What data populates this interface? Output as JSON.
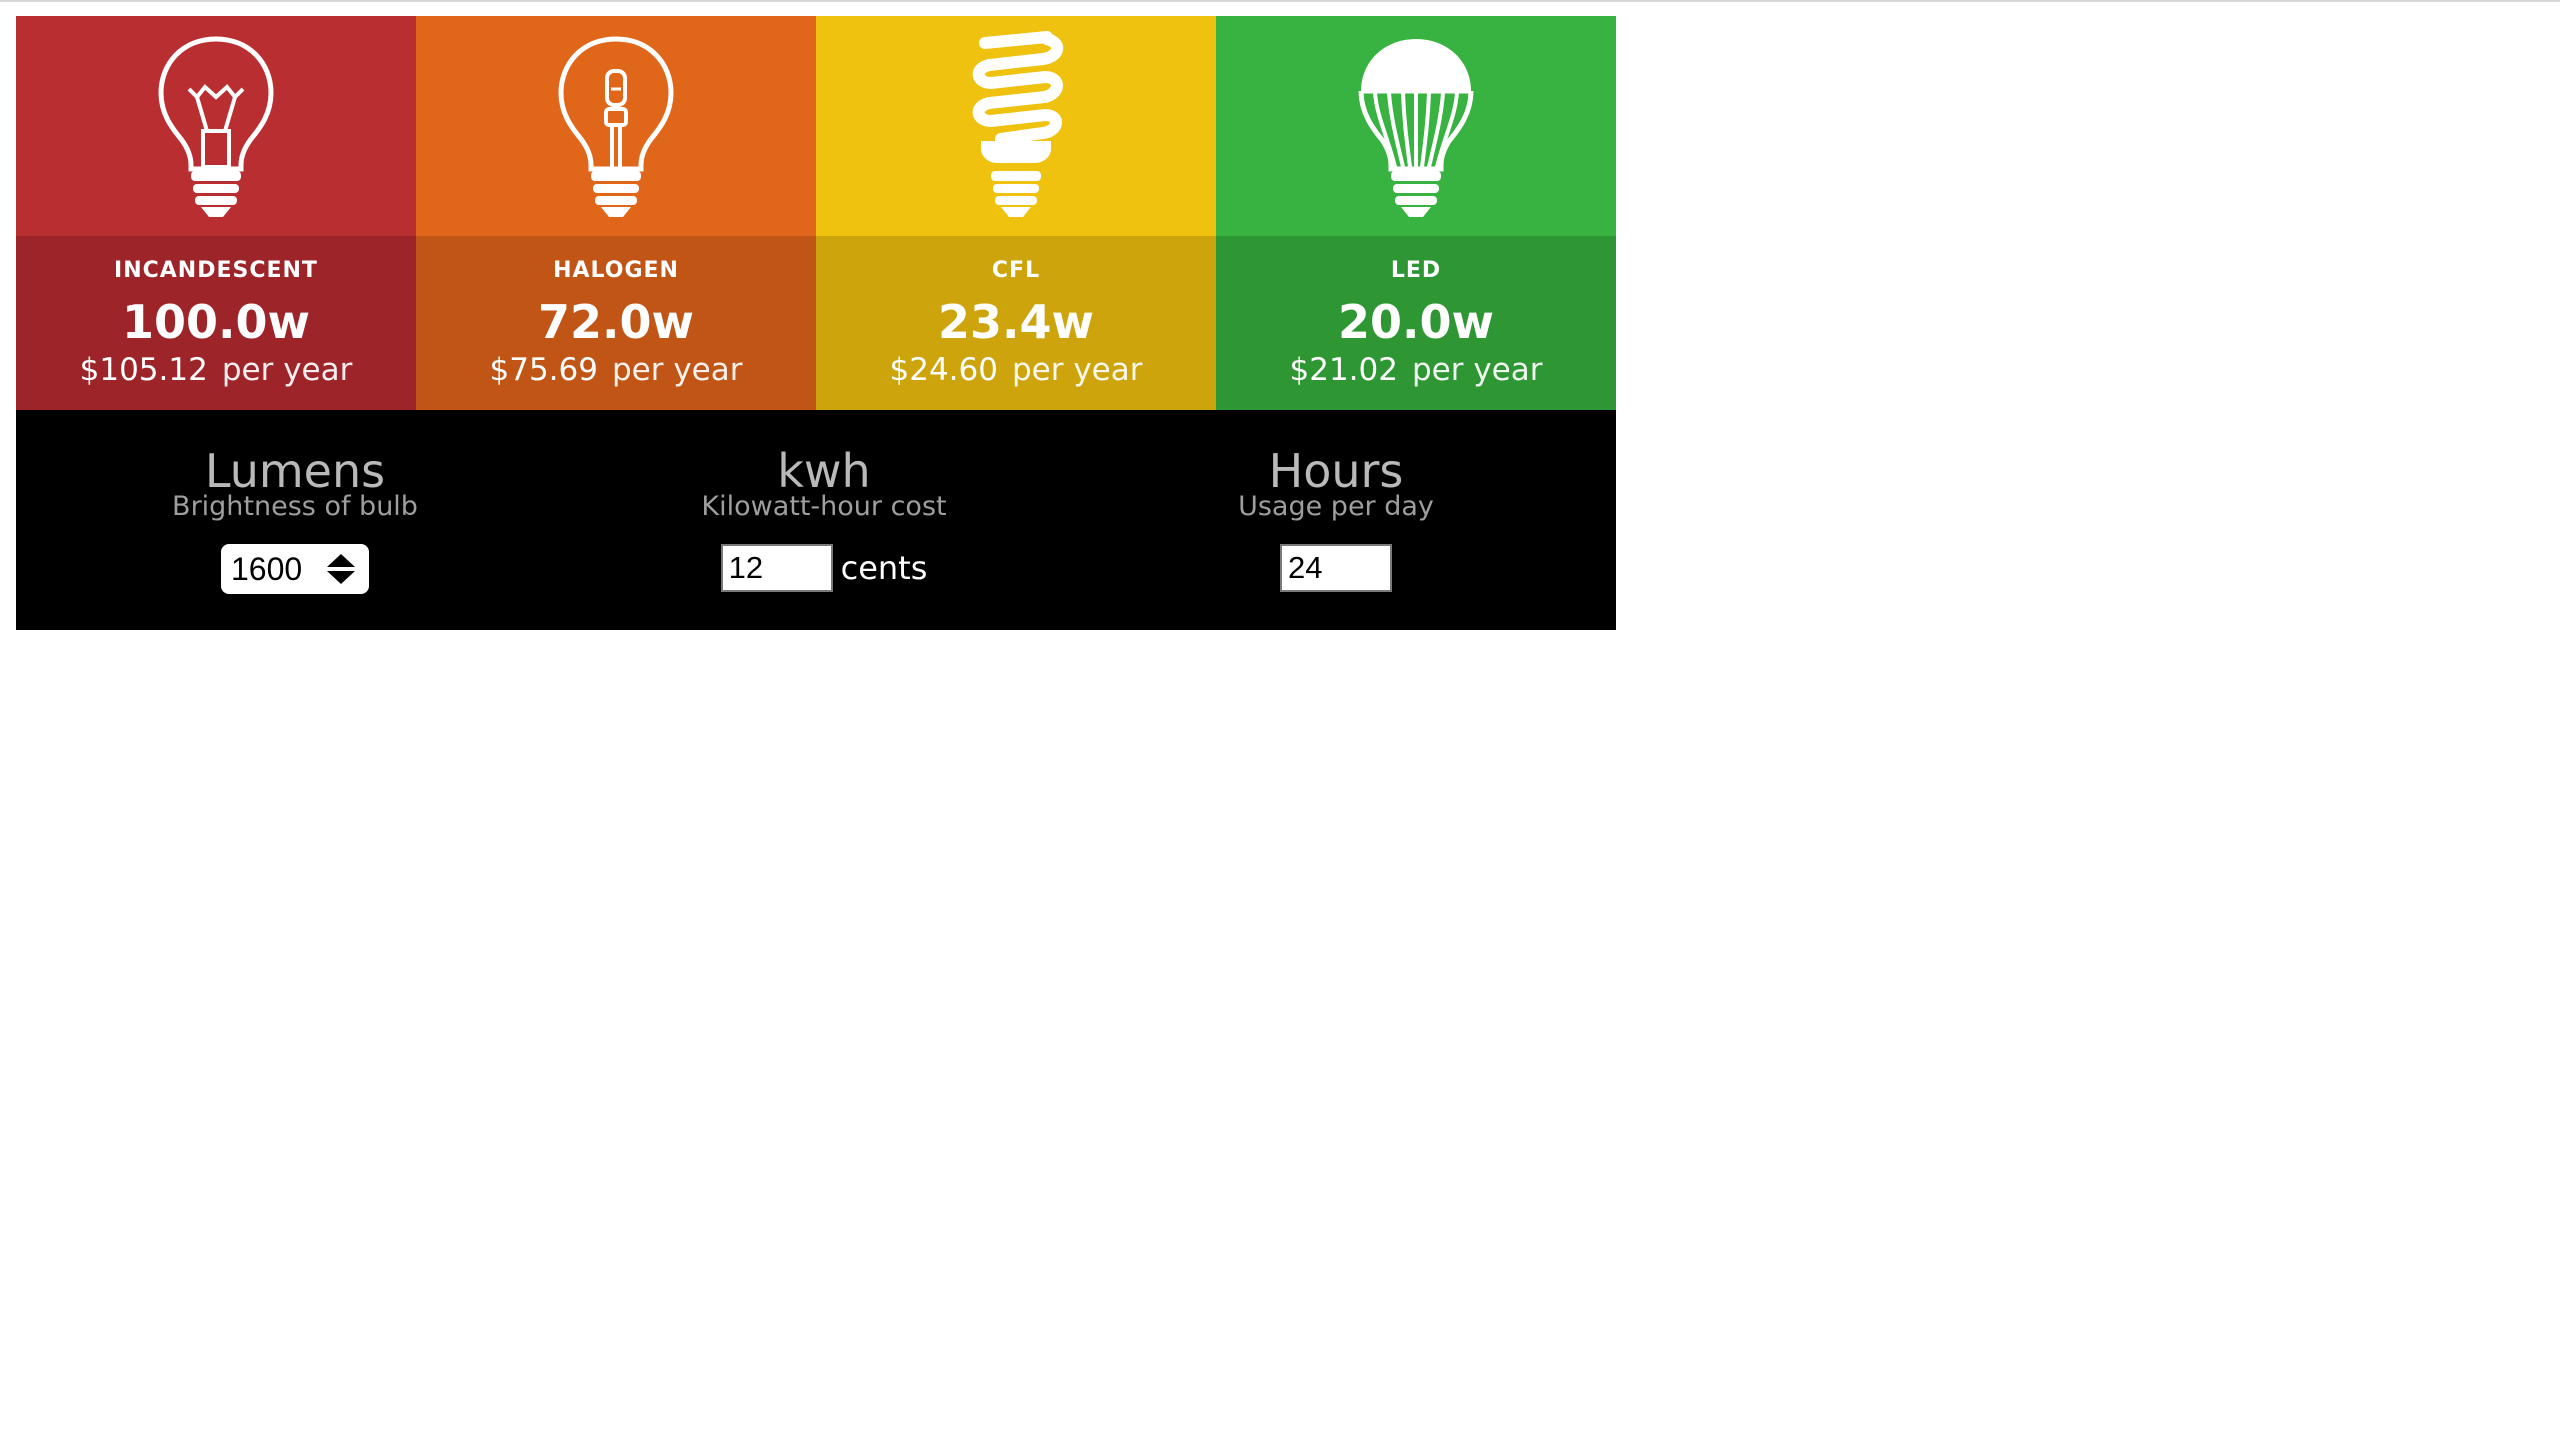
{
  "bulbs": [
    {
      "id": "incandescent",
      "name": "INCANDESCENT",
      "watts": "100.0w",
      "cost": "$105.12",
      "per": "per year",
      "icon": "incandescent-bulb-icon",
      "color": "#b92e30"
    },
    {
      "id": "halogen",
      "name": "HALOGEN",
      "watts": "72.0w",
      "cost": "$75.69",
      "per": "per year",
      "icon": "halogen-bulb-icon",
      "color": "#e0661a"
    },
    {
      "id": "cfl",
      "name": "CFL",
      "watts": "23.4w",
      "cost": "$24.60",
      "per": "per year",
      "icon": "cfl-bulb-icon",
      "color": "#eec20f"
    },
    {
      "id": "led",
      "name": "LED",
      "watts": "20.0w",
      "cost": "$21.02",
      "per": "per year",
      "icon": "led-bulb-icon",
      "color": "#38b240"
    }
  ],
  "controls": {
    "lumens": {
      "title": "Lumens",
      "subtitle": "Brightness of bulb",
      "value": "1600"
    },
    "kwh": {
      "title": "kwh",
      "subtitle": "Kilowatt-hour cost",
      "value": "12",
      "unit": "cents"
    },
    "hours": {
      "title": "Hours",
      "subtitle": "Usage per day",
      "value": "24"
    }
  }
}
